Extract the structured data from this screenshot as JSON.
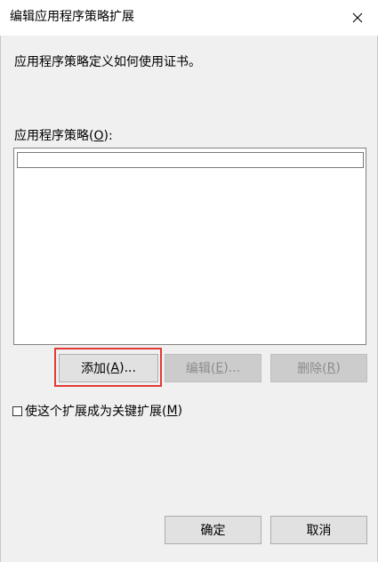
{
  "dialog": {
    "title": "编辑应用程序策略扩展",
    "description": "应用程序策略定义如何使用证书。"
  },
  "list": {
    "label_prefix": "应用程序策略(",
    "label_key": "O",
    "label_suffix": "):",
    "items": [
      ""
    ]
  },
  "buttons": {
    "add": {
      "prefix": "添加(",
      "key": "A",
      "suffix": ")..."
    },
    "edit": {
      "prefix": "编辑(",
      "key": "E",
      "suffix": ")..."
    },
    "remove": {
      "prefix": "删除(",
      "key": "R",
      "suffix": ")"
    },
    "ok": "确定",
    "cancel": "取消"
  },
  "critical_checkbox": {
    "checked": false,
    "label_prefix": "使这个扩展成为关键扩展(",
    "label_key": "M",
    "label_suffix": ")"
  },
  "icons": {
    "close": "close-icon"
  }
}
